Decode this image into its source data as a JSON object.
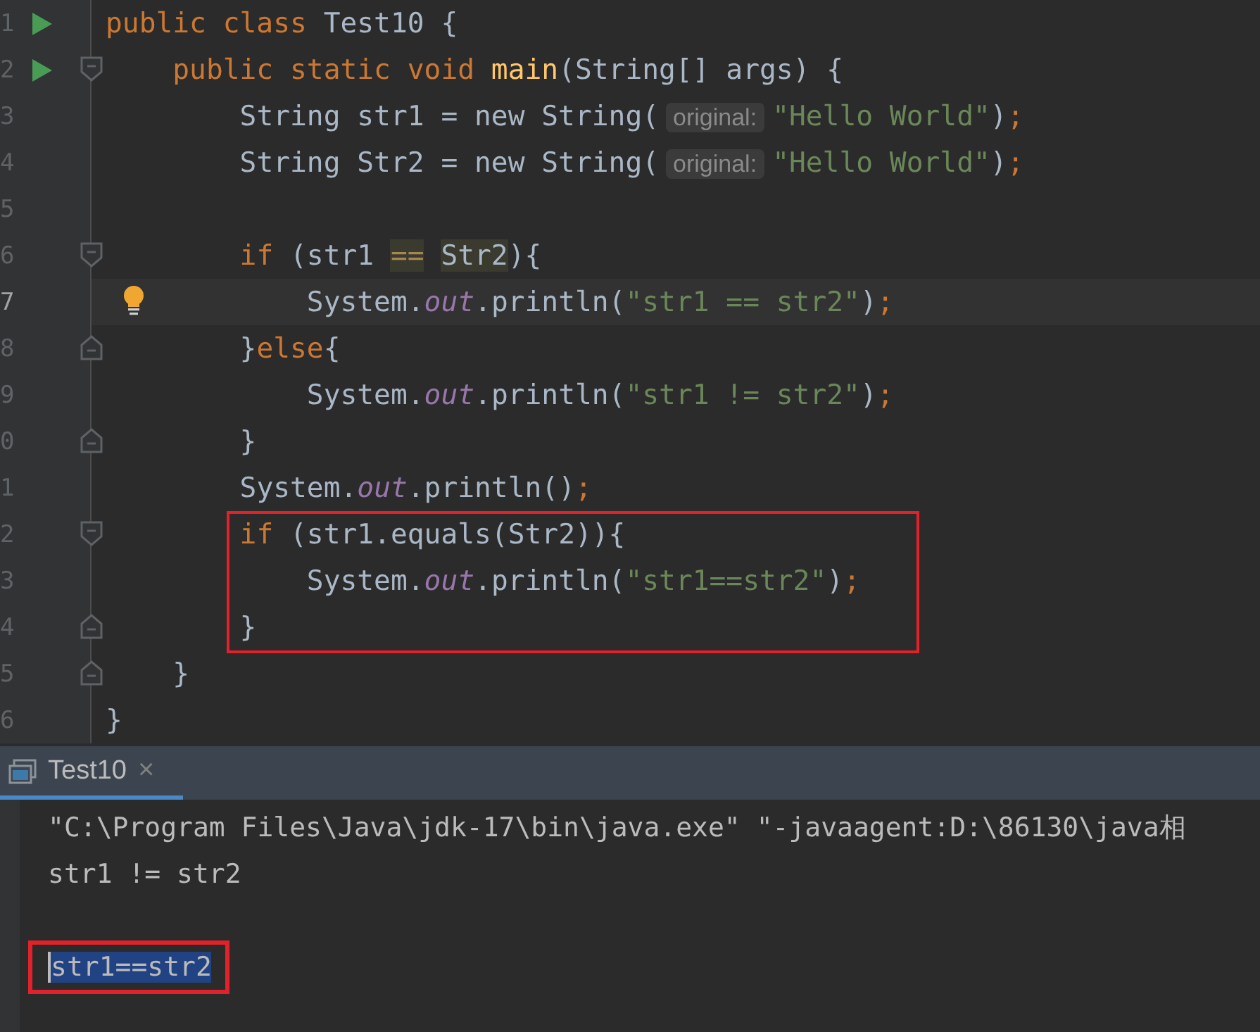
{
  "editor": {
    "lines": [
      {
        "number": "1",
        "run": true,
        "tokens": [
          {
            "keyword": "public class "
          },
          {
            "plain": "Test10 {"
          }
        ]
      },
      {
        "number": "2",
        "run": true,
        "fold_open": true,
        "tokens": [
          {
            "keyword": "    public static void "
          },
          {
            "method": "main"
          },
          {
            "plain": "(String[] args) {"
          }
        ]
      },
      {
        "number": "3",
        "tokens": [
          {
            "plain": "        String str1 = new String("
          },
          {
            "hint": "original:"
          },
          {
            "string": "\"Hello World\""
          },
          {
            "plain": ")"
          },
          {
            "keyword": ";"
          }
        ]
      },
      {
        "number": "4",
        "tokens": [
          {
            "plain": "        String Str2 = new String("
          },
          {
            "hint": "original:"
          },
          {
            "string": "\"Hello World\""
          },
          {
            "plain": ")"
          },
          {
            "keyword": ";"
          }
        ]
      },
      {
        "number": "5"
      },
      {
        "number": "6",
        "fold_open": true,
        "tokens": [
          {
            "keyword": "        if "
          },
          {
            "plain": "(str1 "
          },
          {
            "match_operator": "=="
          },
          {
            "match": "Str2"
          },
          {
            "plain": "){"
          }
        ]
      },
      {
        "number": "7",
        "current": true,
        "bulb": true,
        "tokens": [
          {
            "plain": "            System."
          },
          {
            "field": "out"
          },
          {
            "plain": ".println("
          },
          {
            "string": "\"str1 == str2\""
          },
          {
            "plain": ")"
          },
          {
            "keyword": ";"
          }
        ]
      },
      {
        "number": "8",
        "fold_close": true,
        "tokens": [
          {
            "plain": "        }"
          },
          {
            "keyword": "else"
          },
          {
            "plain": "{"
          }
        ]
      },
      {
        "number": "9",
        "tokens": [
          {
            "plain": "            System."
          },
          {
            "field": "out"
          },
          {
            "plain": ".println("
          },
          {
            "string": "\"str1 != str2\""
          },
          {
            "plain": ")"
          },
          {
            "keyword": ";"
          }
        ]
      },
      {
        "number": "0",
        "fold_close": true,
        "tokens": [
          {
            "plain": "        }"
          }
        ]
      },
      {
        "number": "1",
        "tokens": [
          {
            "plain": "        System."
          },
          {
            "field": "out"
          },
          {
            "plain": ".println()"
          },
          {
            "keyword": ";"
          }
        ]
      },
      {
        "number": "2",
        "fold_open": true,
        "marked": true,
        "tokens": [
          {
            "keyword": "        if "
          },
          {
            "plain": "(str1.equals(Str2)){"
          }
        ]
      },
      {
        "number": "3",
        "marked": true,
        "tokens": [
          {
            "plain": "            System."
          },
          {
            "field": "out"
          },
          {
            "plain": ".println("
          },
          {
            "string": "\"str1==str2\""
          },
          {
            "plain": ")"
          },
          {
            "keyword": ";"
          }
        ]
      },
      {
        "number": "4",
        "fold_close": true,
        "marked": true,
        "tokens": [
          {
            "plain": "        }"
          }
        ]
      },
      {
        "number": "5",
        "fold_close": true,
        "tokens": [
          {
            "plain": "    }"
          }
        ]
      },
      {
        "number": "6",
        "tokens": [
          {
            "plain": "}"
          }
        ]
      }
    ]
  },
  "console": {
    "tab": {
      "label": "Test10",
      "close": "×",
      "selected": true
    },
    "lines": [
      {
        "text": "\"C:\\Program Files\\Java\\jdk-17\\bin\\java.exe\" \"-javaagent:D:\\86130\\java相",
        "selected": false,
        "marked": false,
        "blank_line_before": false
      },
      {
        "text": "str1 != str2",
        "selected": false,
        "marked": false,
        "blank_line_before": false
      },
      {
        "text": "str1==str2",
        "selected": true,
        "marked": true,
        "blank_line_before": true
      }
    ]
  }
}
